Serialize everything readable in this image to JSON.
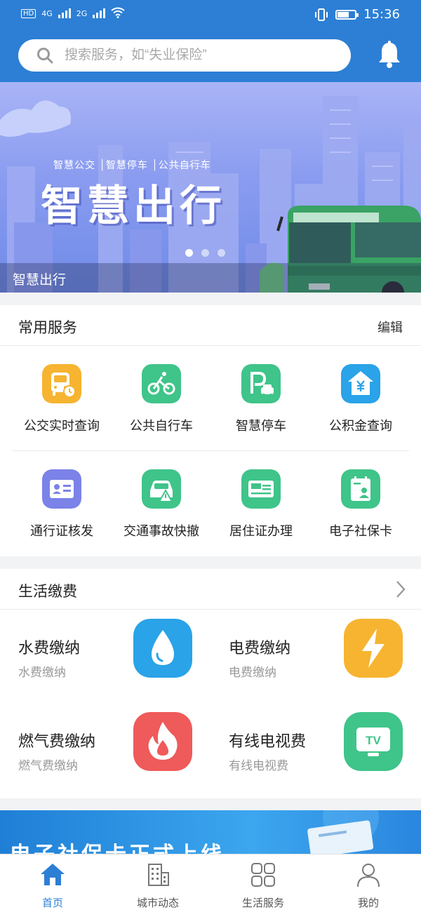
{
  "status_bar": {
    "network_1": "4G",
    "network_2": "2G",
    "time": "15:36"
  },
  "search": {
    "placeholder": "搜索服务，如“失业保险”"
  },
  "banner": {
    "subtitle": "智慧公交 │智慧停车 │公共自行车",
    "title": "智慧出行",
    "caption": "智慧出行",
    "slide_count": 3,
    "active_slide": 1
  },
  "common_services": {
    "title": "常用服务",
    "edit_label": "编辑",
    "items": [
      {
        "label": "公交实时查询",
        "icon": "bus-clock-icon",
        "color": "#f6b431"
      },
      {
        "label": "公共自行车",
        "icon": "bicycle-icon",
        "color": "#3fc48a"
      },
      {
        "label": "智慧停车",
        "icon": "parking-icon",
        "color": "#3fc48a"
      },
      {
        "label": "公积金查询",
        "icon": "house-yuan-icon",
        "color": "#2aa3e8"
      },
      {
        "label": "通行证核发",
        "icon": "id-card-icon",
        "color": "#7b82e8"
      },
      {
        "label": "交通事故快撤",
        "icon": "car-warning-icon",
        "color": "#3fc48a"
      },
      {
        "label": "居住证办理",
        "icon": "residence-card-icon",
        "color": "#3fc48a"
      },
      {
        "label": "电子社保卡",
        "icon": "social-security-card-icon",
        "color": "#3fc48a"
      }
    ]
  },
  "life_payment": {
    "title": "生活缴费",
    "items": [
      {
        "title": "水费缴纳",
        "subtitle": "水费缴纳",
        "icon": "water-drop-icon",
        "color": "#2aa3e8"
      },
      {
        "title": "电费缴纳",
        "subtitle": "电费缴纳",
        "icon": "lightning-icon",
        "color": "#f6b431"
      },
      {
        "title": "燃气费缴纳",
        "subtitle": "燃气费缴纳",
        "icon": "flame-icon",
        "color": "#ef5a5a"
      },
      {
        "title": "有线电视费",
        "subtitle": "有线电视费",
        "icon": "tv-icon",
        "color": "#3fc48a",
        "icon_text": "TV"
      }
    ]
  },
  "promo": {
    "text": "电子社保卡正式上线"
  },
  "tabs": [
    {
      "label": "首页",
      "icon": "home-icon",
      "active": true
    },
    {
      "label": "城市动态",
      "icon": "building-icon",
      "active": false
    },
    {
      "label": "生活服务",
      "icon": "grid-icon",
      "active": false
    },
    {
      "label": "我的",
      "icon": "person-icon",
      "active": false
    }
  ],
  "colors": {
    "primary": "#2c7fd4",
    "active_tab": "#2d7fd6"
  }
}
